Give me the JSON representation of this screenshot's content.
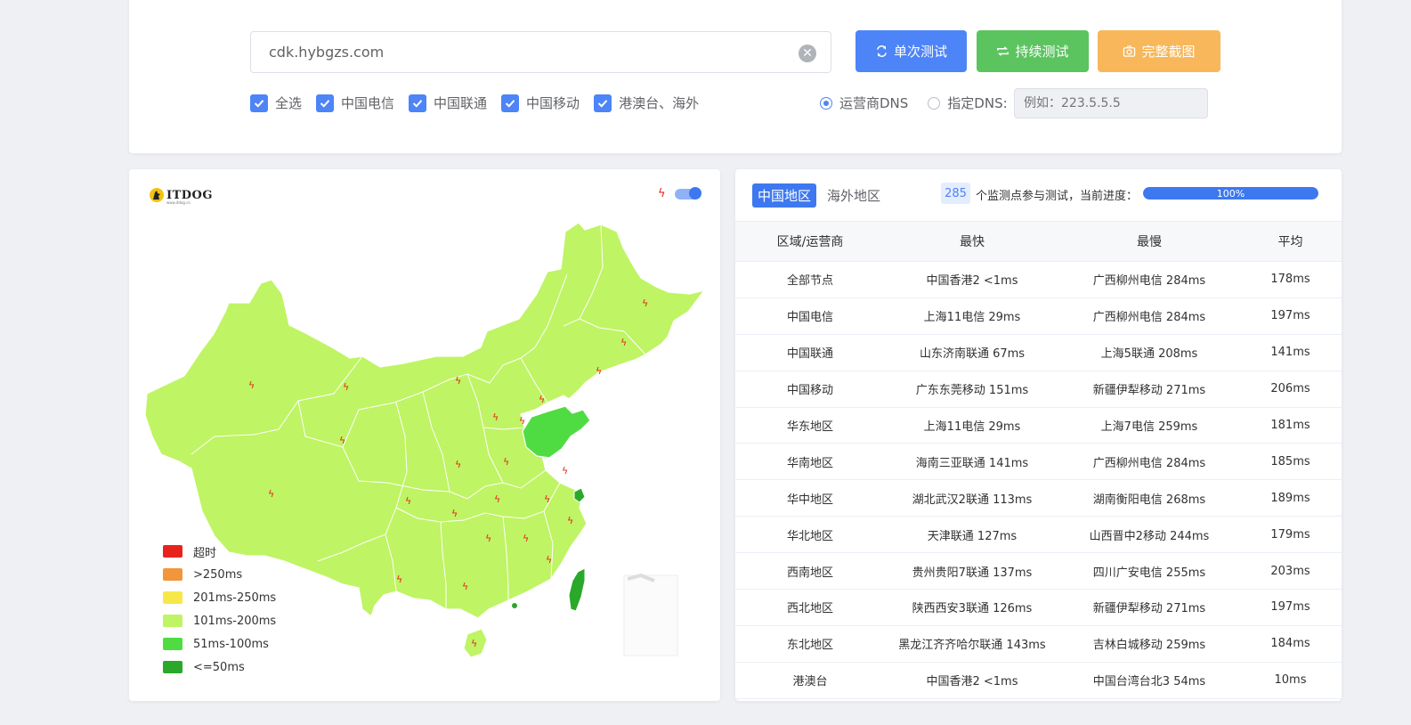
{
  "search": {
    "value": "cdk.hybgzs.com",
    "clear_icon": "close-circle-icon"
  },
  "buttons": {
    "single": "单次测试",
    "continue": "持续测试",
    "screenshot": "完整截图"
  },
  "filters": [
    "全选",
    "中国电信",
    "中国联通",
    "中国移动",
    "港澳台、海外"
  ],
  "dns": {
    "option_isp": "运营商DNS",
    "option_custom": "指定DNS:",
    "placeholder": "例如：223.5.5.5"
  },
  "map": {
    "logo_text": "ITDOG",
    "logo_sub": "www.itdog.cn",
    "legend": [
      {
        "label": "超时",
        "color": "#e8231c"
      },
      {
        "label": ">250ms",
        "color": "#f2963b"
      },
      {
        "label": "201ms-250ms",
        "color": "#f7e84a"
      },
      {
        "label": "101ms-200ms",
        "color": "#bff464"
      },
      {
        "label": "51ms-100ms",
        "color": "#4fdc43"
      },
      {
        "label": "<=50ms",
        "color": "#2aa82a"
      }
    ]
  },
  "results": {
    "tab_china": "中国地区",
    "tab_overseas": "海外地区",
    "node_count": "285",
    "progress_label": "个监测点参与测试，当前进度：",
    "progress_value": "100%",
    "progress_fraction": 1.0,
    "columns": [
      "区域/运营商",
      "最快",
      "最慢",
      "平均"
    ],
    "rows": [
      [
        "全部节点",
        "中国香港2 <1ms",
        "广西柳州电信 284ms",
        "178ms"
      ],
      [
        "中国电信",
        "上海11电信 29ms",
        "广西柳州电信 284ms",
        "197ms"
      ],
      [
        "中国联通",
        "山东济南联通 67ms",
        "上海5联通 208ms",
        "141ms"
      ],
      [
        "中国移动",
        "广东东莞移动 151ms",
        "新疆伊犁移动 271ms",
        "206ms"
      ],
      [
        "华东地区",
        "上海11电信 29ms",
        "上海7电信 259ms",
        "181ms"
      ],
      [
        "华南地区",
        "海南三亚联通 141ms",
        "广西柳州电信 284ms",
        "185ms"
      ],
      [
        "华中地区",
        "湖北武汉2联通 113ms",
        "湖南衡阳电信 268ms",
        "189ms"
      ],
      [
        "华北地区",
        "天津联通 127ms",
        "山西晋中2移动 244ms",
        "179ms"
      ],
      [
        "西南地区",
        "贵州贵阳7联通 137ms",
        "四川广安电信 255ms",
        "203ms"
      ],
      [
        "西北地区",
        "陕西西安3联通 126ms",
        "新疆伊犁移动 271ms",
        "197ms"
      ],
      [
        "东北地区",
        "黑龙江齐齐哈尔联通 143ms",
        "吉林白城移动 259ms",
        "184ms"
      ],
      [
        "港澳台",
        "中国香港2 <1ms",
        "中国台湾台北3 54ms",
        "10ms"
      ]
    ]
  }
}
